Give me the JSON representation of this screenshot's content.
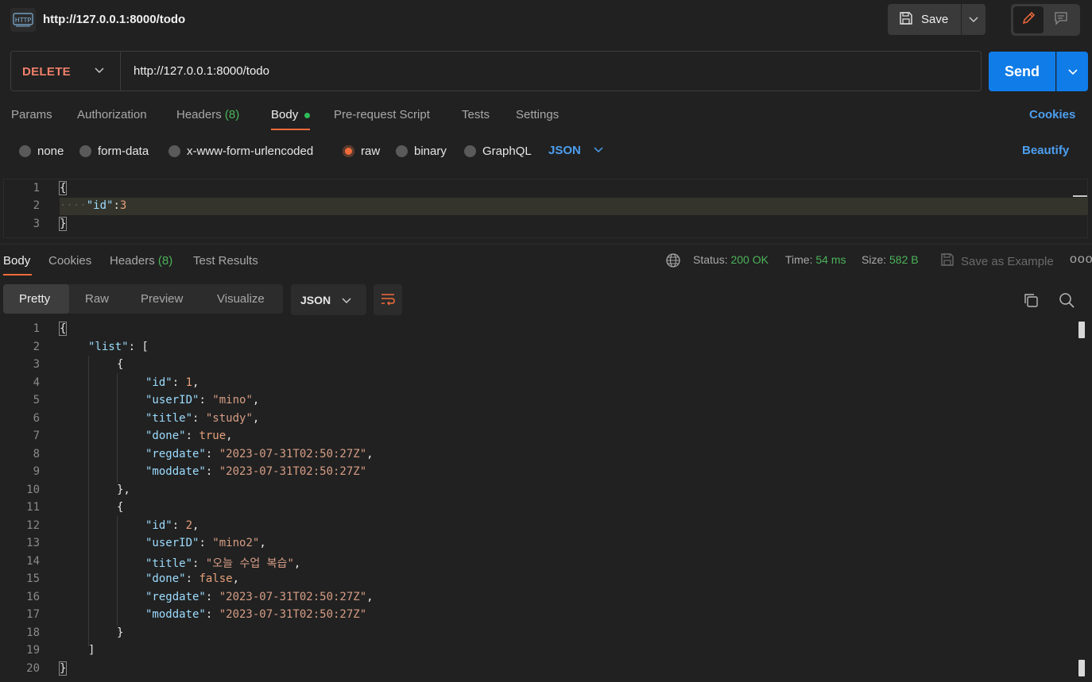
{
  "header": {
    "url_title": "http://127.0.0.1:8000/todo",
    "save_label": "Save"
  },
  "request": {
    "method": "DELETE",
    "url": "http://127.0.0.1:8000/todo",
    "send_label": "Send"
  },
  "request_tabs": {
    "params": "Params",
    "authorization": "Authorization",
    "headers": "Headers",
    "headers_count": "(8)",
    "body": "Body",
    "prerequest": "Pre-request Script",
    "tests": "Tests",
    "settings": "Settings",
    "cookies": "Cookies"
  },
  "body_options": {
    "none": "none",
    "form_data": "form-data",
    "urlencoded": "x-www-form-urlencoded",
    "raw": "raw",
    "binary": "binary",
    "graphql": "GraphQL",
    "format": "JSON",
    "beautify": "Beautify",
    "selected": "raw"
  },
  "request_body": {
    "line_numbers": [
      "1",
      "2",
      "3"
    ],
    "open_brace": "{",
    "key": "\"id\"",
    "colon": ":",
    "value": "3",
    "close_brace": "}"
  },
  "response_tabs": {
    "body": "Body",
    "cookies": "Cookies",
    "headers": "Headers",
    "headers_count": "(8)",
    "test_results": "Test Results"
  },
  "response_meta": {
    "status_label": "Status:",
    "status_value": "200 OK",
    "time_label": "Time:",
    "time_value": "54 ms",
    "size_label": "Size:",
    "size_value": "582 B",
    "save_example": "Save as Example",
    "more": "ooo"
  },
  "response_view": {
    "pretty": "Pretty",
    "raw": "Raw",
    "preview": "Preview",
    "visualize": "Visualize",
    "format": "JSON"
  },
  "response_body": {
    "line_numbers": [
      "1",
      "2",
      "3",
      "4",
      "5",
      "6",
      "7",
      "8",
      "9",
      "10",
      "11",
      "12",
      "13",
      "14",
      "15",
      "16",
      "17",
      "18",
      "19",
      "20"
    ],
    "list_key": "\"list\"",
    "items": [
      {
        "id_key": "\"id\"",
        "id": "1",
        "userID_key": "\"userID\"",
        "userID": "\"mino\"",
        "title_key": "\"title\"",
        "title": "\"study\"",
        "done_key": "\"done\"",
        "done": "true",
        "regdate_key": "\"regdate\"",
        "regdate": "\"2023-07-31T02:50:27Z\"",
        "moddate_key": "\"moddate\"",
        "moddate": "\"2023-07-31T02:50:27Z\""
      },
      {
        "id_key": "\"id\"",
        "id": "2",
        "userID_key": "\"userID\"",
        "userID": "\"mino2\"",
        "title_key": "\"title\"",
        "title": "\"오늘 수업 복습\"",
        "done_key": "\"done\"",
        "done": "false",
        "regdate_key": "\"regdate\"",
        "regdate": "\"2023-07-31T02:50:27Z\"",
        "moddate_key": "\"moddate\"",
        "moddate": "\"2023-07-31T02:50:27Z\""
      }
    ]
  },
  "icons": {
    "http": "http-icon",
    "save": "floppy-disk-icon",
    "edit": "pencil-icon",
    "comment": "comment-icon",
    "globe": "globe-icon",
    "copy": "copy-icon",
    "search": "search-icon",
    "wrap": "wrap-lines-icon"
  },
  "colors": {
    "accent_orange": "#f26b3a",
    "send_blue": "#0f7ce8",
    "link_blue": "#4d9ff0",
    "status_green": "#4cb35a",
    "method_red": "#f0806a"
  }
}
